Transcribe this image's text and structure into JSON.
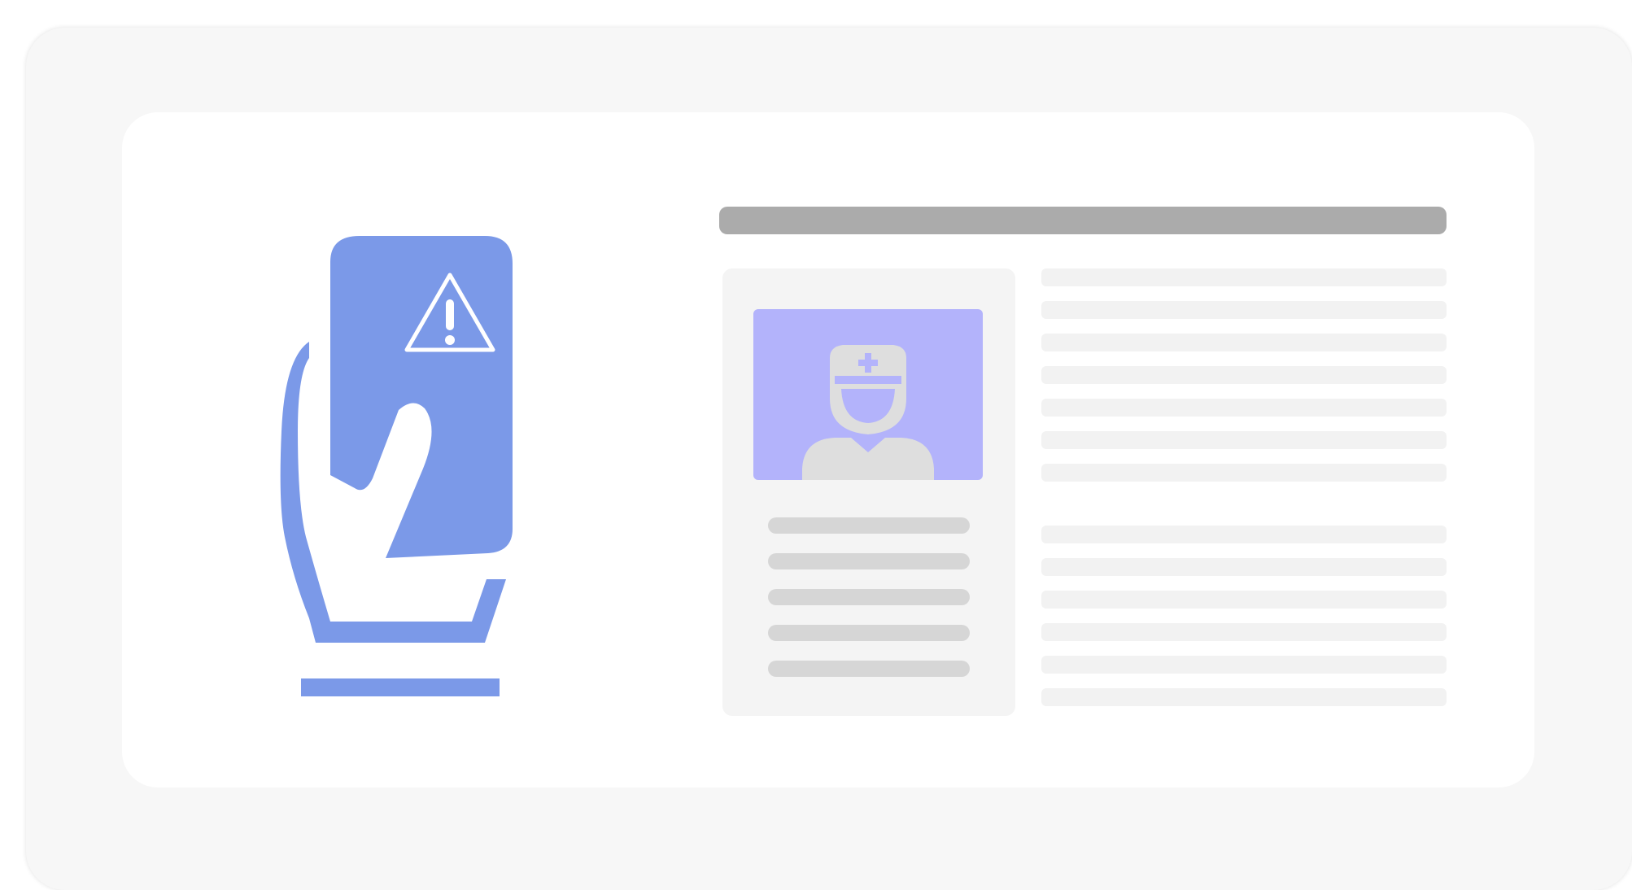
{
  "colors": {
    "outer_background": "#f7f7f7",
    "panel_background": "#ffffff",
    "accent_blue": "#7b99e8",
    "avatar_background": "#b3b3fb",
    "avatar_figure": "#dedede",
    "title_bar": "#ababab",
    "placeholder_line": "#d6d6d6",
    "text_line": "#f2f2f2"
  },
  "icons": {
    "hand": "hand-holding-card-icon",
    "warning": "warning-triangle-icon",
    "avatar": "doctor-avatar-icon",
    "medical_cross": "medical-cross-icon"
  }
}
